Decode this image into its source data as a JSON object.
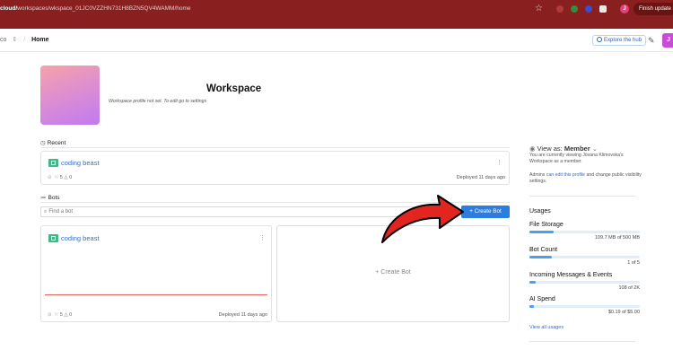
{
  "browser": {
    "url_host": "cloud/",
    "url_path": "workspaces/wkspace_01JC0VZZHN731H8BZN5QV4WAMM/home",
    "profile_initial": "J",
    "finish_update": "Finish update"
  },
  "header": {
    "workspace_short": "co",
    "switch_glyph": "⇕",
    "separator": "/",
    "page": "Home",
    "explore": "Explore the hub",
    "tool_icon": "brush-icon",
    "user_initial": "J"
  },
  "workspace": {
    "title": "Workspace",
    "subtitle": "Workspace profile not set. To edit go to settings"
  },
  "recent": {
    "label": "Recent",
    "card": {
      "name": "coding beast",
      "stats": "⁙ 5  △ 0",
      "deployed": "Deployed 11 days ago"
    }
  },
  "bots": {
    "label": "Bots",
    "search_placeholder": "Find a bot",
    "create_button": "+  Create Bot",
    "card": {
      "name": "coding beast",
      "stats": "⁙ 5  △ 0",
      "deployed": "Deployed 11 days ago"
    },
    "create_card": "+  Create Bot"
  },
  "right_panel": {
    "view_as_prefix": "View as:",
    "view_as_role": "Member",
    "viewing_note": "You are currently viewing Jovana Klimovska's Workspace as a member.",
    "admins_prefix": "Admins",
    "admins_link": "can edit this profile",
    "admins_suffix": "and change public visibility settings.",
    "usages_title": "Usages",
    "usages": [
      {
        "label": "File Storage",
        "value": "109.7 MB of 500 MB",
        "fraction": 0.22
      },
      {
        "label": "Bot Count",
        "value": "1 of 5",
        "fraction": 0.2
      },
      {
        "label": "Incoming Messages & Events",
        "value": "108 of 2K",
        "fraction": 0.054
      },
      {
        "label": "AI Spend",
        "value": "$0.19 of $5.00",
        "fraction": 0.038
      }
    ],
    "view_all": "View all usages"
  },
  "colors": {
    "accent": "#2c7de0",
    "browser_bar": "#8a1f1f",
    "annotation_arrow": "#e2261f"
  }
}
